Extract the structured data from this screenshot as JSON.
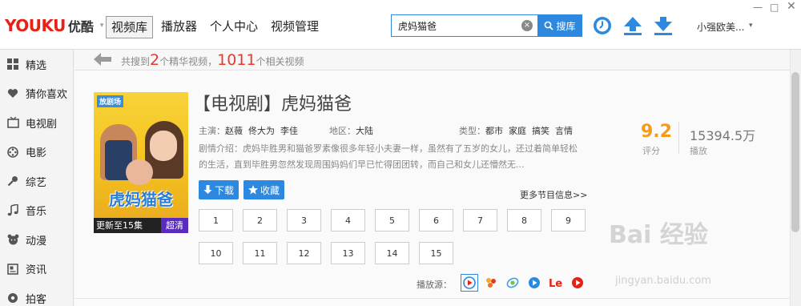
{
  "app": {
    "logo_brand": "YOUKU",
    "logo_cn": "优酷"
  },
  "nav": {
    "tabs": [
      "视频库",
      "播放器",
      "个人中心",
      "视频管理"
    ],
    "active_index": 0
  },
  "search": {
    "query": "虎妈猫爸",
    "button_label": "搜库"
  },
  "user": {
    "name": "小强欧美..."
  },
  "sidebar": {
    "items": [
      {
        "label": "精选",
        "icon": "grid-icon"
      },
      {
        "label": "猜你喜欢",
        "icon": "heart-icon"
      },
      {
        "label": "电视剧",
        "icon": "tv-icon"
      },
      {
        "label": "电影",
        "icon": "film-reel-icon"
      },
      {
        "label": "综艺",
        "icon": "microphone-icon"
      },
      {
        "label": "音乐",
        "icon": "music-note-icon"
      },
      {
        "label": "动漫",
        "icon": "bear-face-icon"
      },
      {
        "label": "资讯",
        "icon": "news-icon"
      },
      {
        "label": "拍客",
        "icon": "record-icon"
      }
    ]
  },
  "results": {
    "prefix": "共搜到",
    "premium_count": "2",
    "premium_text": "个精华视频，",
    "total_count": "1011",
    "total_text": "个相关视频"
  },
  "show": {
    "title": "【电视剧】虎妈猫爸",
    "cast_label": "主演：",
    "cast": [
      "赵薇",
      "佟大为",
      "李佳"
    ],
    "region_label": "地区：",
    "region": "大陆",
    "genre_label": "类型：",
    "genres": [
      "都市",
      "家庭",
      "搞笑",
      "言情"
    ],
    "description": "剧情介绍：虎妈毕胜男和猫爸罗素像很多年轻小夫妻一样，虽然有了五岁的女儿，还过着简单轻松的生活，直到毕胜男忽然发现周围妈妈们早已忙得团团转，而自己和女儿还懵然无...",
    "download_label": "下载",
    "favorite_label": "收藏",
    "more_info_label": "更多节目信息",
    "rating": "9.2",
    "rating_label": "评分",
    "plays": "15394.5万",
    "plays_label": "播放",
    "poster_episode": "更新至15集",
    "poster_quality": "超清",
    "poster_logo": "放剧场",
    "poster_title": "虎妈猫爸"
  },
  "episodes": [
    "1",
    "2",
    "3",
    "4",
    "5",
    "6",
    "7",
    "8",
    "9",
    "10",
    "11",
    "12",
    "13",
    "14",
    "15"
  ],
  "sources": {
    "label": "播放源：",
    "items": [
      "youku-icon",
      "tudou-icon",
      "iqiyi-icon",
      "pptv-icon",
      "letv-icon",
      "tencent-icon"
    ]
  },
  "watermark": {
    "main": "Bai 经验",
    "sub": "jingyan.baidu.com"
  },
  "colors": {
    "accent": "#2d89e0",
    "brand_red": "#e62117",
    "rating": "#f29b1d",
    "count_red": "#e33c2e"
  }
}
